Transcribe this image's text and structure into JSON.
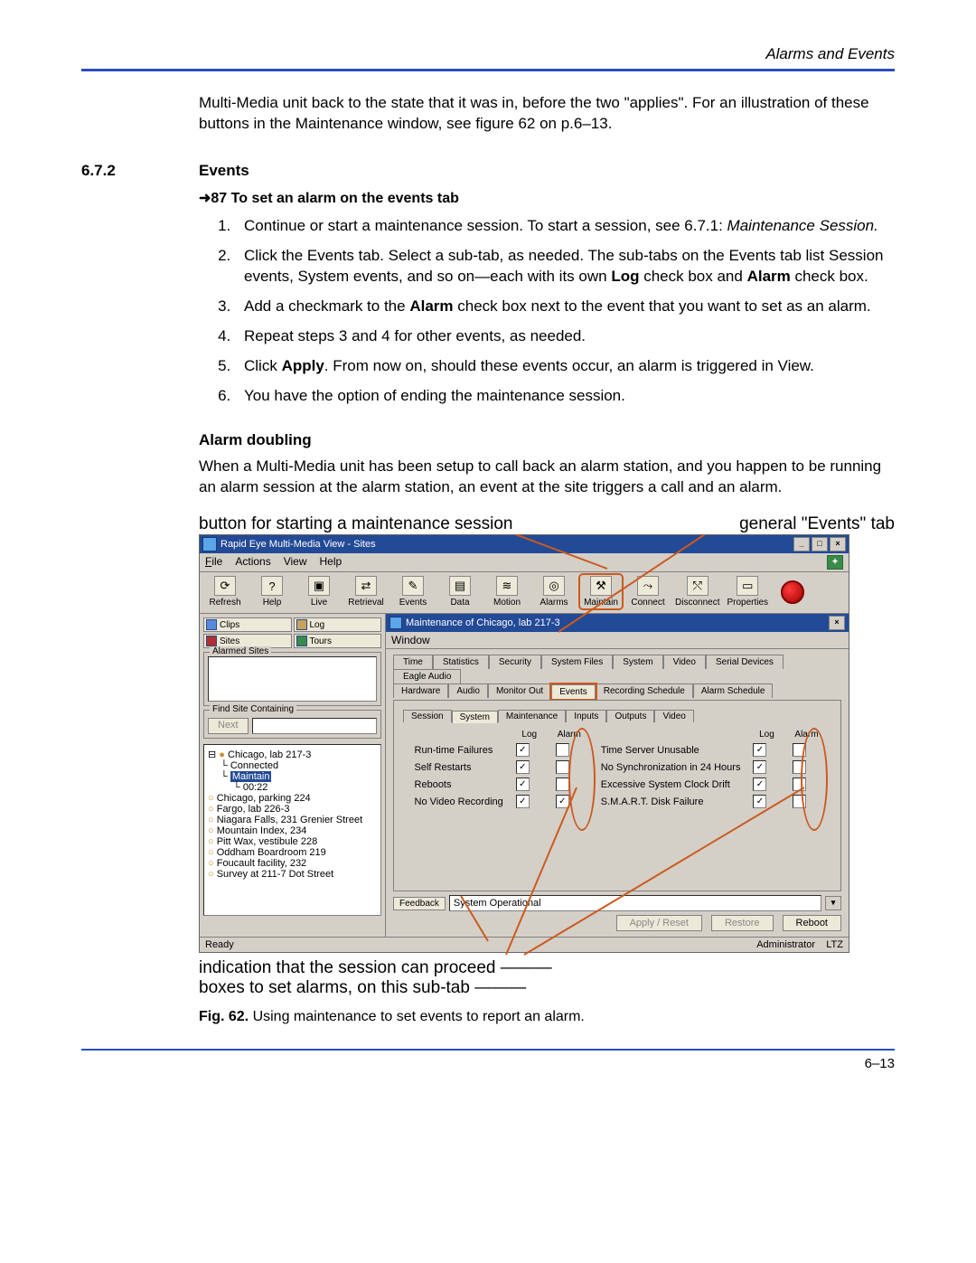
{
  "header_right": "Alarms and Events",
  "intro_para": "Multi-Media unit back to the state that it was in, before the two \"applies\". For an illustration of these buttons in the Maintenance window, see figure 62 on p.6–13.",
  "section_number": "6.7.2",
  "section_title": "Events",
  "procedure_title": "➜87  To set an alarm on the events tab",
  "steps": {
    "s1a": "Continue or start a maintenance session. To start a session, see 6.7.1: ",
    "s1b": "Maintenance Session.",
    "s2a": "Click the Events tab. Select a sub-tab, as needed. The sub-tabs on the Events tab list Session events, System events, and so on—each with its own ",
    "s2b": "Log",
    "s2c": " check box and ",
    "s2d": "Alarm",
    "s2e": " check box.",
    "s3a": "Add a checkmark to the ",
    "s3b": "Alarm",
    "s3c": " check box next to the event that you want to set as an alarm.",
    "s4": "Repeat steps 3 and 4 for other events, as needed.",
    "s5a": "Click ",
    "s5b": "Apply",
    "s5c": ". From now on, should these events occur, an alarm is triggered in View.",
    "s6": "You have the option of ending the maintenance session."
  },
  "alarm_doubling_head": "Alarm doubling",
  "alarm_doubling_text": "When a Multi-Media unit has been setup to call back an alarm station, and you happen to be running an alarm session at the alarm station, an event at the site triggers a call and an alarm.",
  "callout_top_left": "button for starting a maintenance session",
  "callout_top_right": "general \"Events\" tab",
  "callout_bottom_1": "indication that the session can proceed",
  "callout_bottom_2": "boxes to set alarms, on this sub-tab",
  "app": {
    "title": "Rapid Eye Multi-Media View - Sites",
    "menus": {
      "file": "File",
      "actions": "Actions",
      "view": "View",
      "help": "Help"
    },
    "toolbar": {
      "refresh": "Refresh",
      "help": "Help",
      "live": "Live",
      "retrieval": "Retrieval",
      "events": "Events",
      "data": "Data",
      "motion": "Motion",
      "alarms": "Alarms",
      "maintain": "Maintain",
      "connect": "Connect",
      "disconnect": "Disconnect",
      "properties": "Properties"
    },
    "left_tabs": {
      "clips": "Clips",
      "log": "Log",
      "sites": "Sites",
      "tours": "Tours"
    },
    "alarmed_sites_label": "Alarmed Sites",
    "find_label": "Find Site Containing",
    "next_btn": "Next",
    "tree": {
      "n0": "Chicago, lab 217-3",
      "n1": "Connected",
      "n2": "Maintain",
      "n3": "00:22",
      "n4": "Chicago, parking 224",
      "n5": "Fargo, lab 226-3",
      "n6": "Niagara Falls, 231 Grenier Street",
      "n7": "Mountain Index, 234",
      "n8": "Pitt Wax, vestibule 228",
      "n9": "Oddham Boardroom 219",
      "n10": "Foucault facility, 232",
      "n11": "Survey at 211-7 Dot Street"
    },
    "maint_title": "Maintenance of Chicago, lab 217-3",
    "maint_menu": "Window",
    "outer_tabs": {
      "time": "Time",
      "statistics": "Statistics",
      "security": "Security",
      "system_files": "System Files",
      "system": "System",
      "video": "Video",
      "serial": "Serial Devices",
      "eagle": "Eagle Audio",
      "hardware": "Hardware",
      "audio": "Audio",
      "monitor": "Monitor Out",
      "events": "Events",
      "rec": "Recording Schedule",
      "alarm_sched": "Alarm Schedule"
    },
    "sub_tabs": {
      "session": "Session",
      "system": "System",
      "maintenance": "Maintenance",
      "inputs": "Inputs",
      "outputs": "Outputs",
      "video": "Video"
    },
    "col_headers": {
      "log": "Log",
      "alarm": "Alarm"
    },
    "left_events": {
      "e1": "Run-time Failures",
      "e2": "Self Restarts",
      "e3": "Reboots",
      "e4": "No Video Recording"
    },
    "right_events": {
      "e1": "Time Server Unusable",
      "e2": "No Synchronization in 24 Hours",
      "e3": "Excessive System Clock Drift",
      "e4": "S.M.A.R.T. Disk Failure"
    },
    "feedback_label": "Feedback",
    "feedback_value": "System Operational",
    "btns": {
      "apply": "Apply / Reset",
      "restore": "Restore",
      "reboot": "Reboot"
    },
    "status_left": "Ready",
    "status_user": "Administrator",
    "status_tz": "LTZ"
  },
  "fig_number": "Fig. 62.",
  "fig_caption": " Using maintenance to set events to report an alarm.",
  "page_num": "6–13"
}
